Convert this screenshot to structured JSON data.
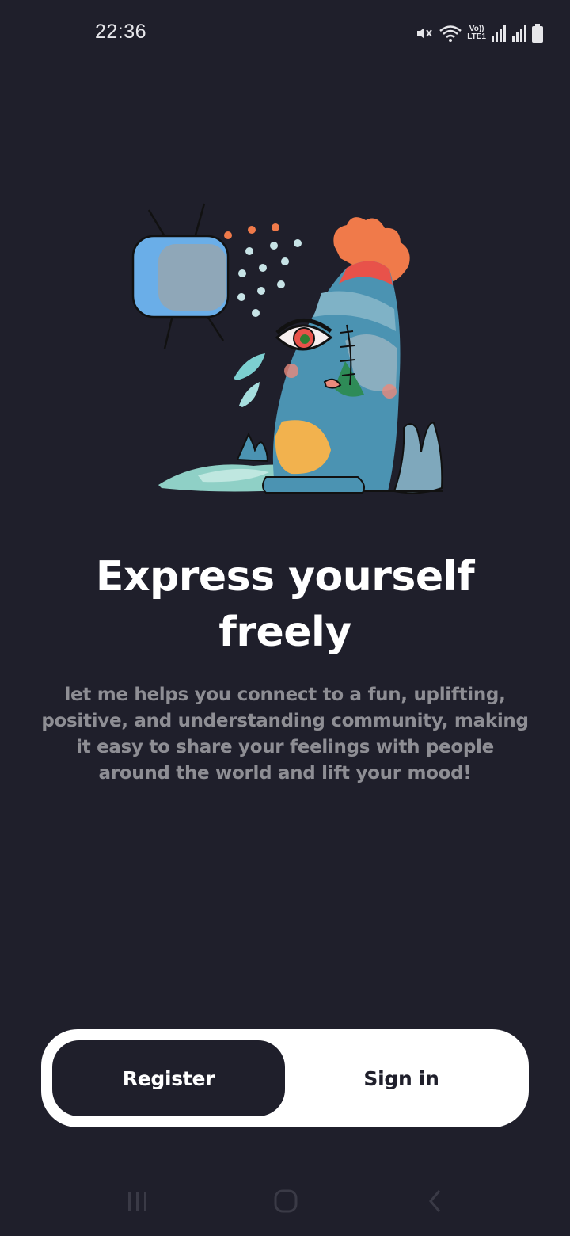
{
  "status_bar": {
    "time": "22:36",
    "icons": [
      "mute-icon",
      "wifi-icon",
      "volte-lte-icon",
      "signal-icon",
      "signal-icon",
      "battery-icon"
    ],
    "volte_top": "Vo))",
    "volte_bottom": "LTE1"
  },
  "onboarding": {
    "illustration": "crying-cartoon-creature-with-tv",
    "headline": "Express yourself freely",
    "description": "let me helps you connect to a fun, uplifting, positive, and understanding community, making it easy to share your feelings with people around the world and lift your mood!"
  },
  "auth": {
    "register_label": "Register",
    "signin_label": "Sign in"
  },
  "nav_bar": {
    "icons": [
      "recent-apps-icon",
      "home-icon",
      "back-icon"
    ]
  },
  "colors": {
    "background": "#1f1f2b",
    "text_primary": "#ffffff",
    "text_secondary": "#8e8e94",
    "switch_background": "#ffffff"
  }
}
